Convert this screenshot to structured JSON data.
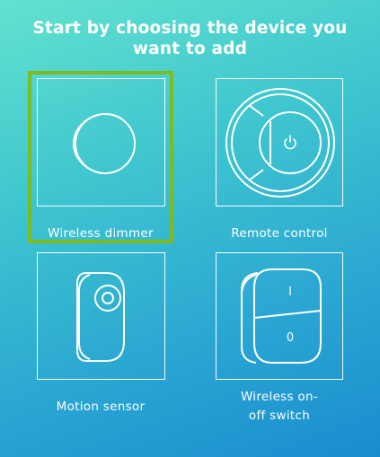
{
  "header": {
    "title_line1": "Start by choosing the device you",
    "title_line2": "want to add"
  },
  "devices": [
    {
      "label": "Wireless dimmer",
      "icon": "dimmer-icon",
      "selected": true
    },
    {
      "label": "Remote control",
      "icon": "remote-control-icon",
      "selected": false
    },
    {
      "label": "Motion sensor",
      "icon": "motion-sensor-icon",
      "selected": false
    },
    {
      "label_line1": "Wireless on-",
      "label_line2": "off switch",
      "icon": "on-off-switch-icon",
      "selected": false
    }
  ],
  "switch_glyphs": {
    "on": "I",
    "off": "0"
  },
  "colors": {
    "selection": "#7dbb23",
    "gradient_start": "#62e2cf",
    "gradient_end": "#1a8ccf",
    "foreground": "#ffffff"
  }
}
